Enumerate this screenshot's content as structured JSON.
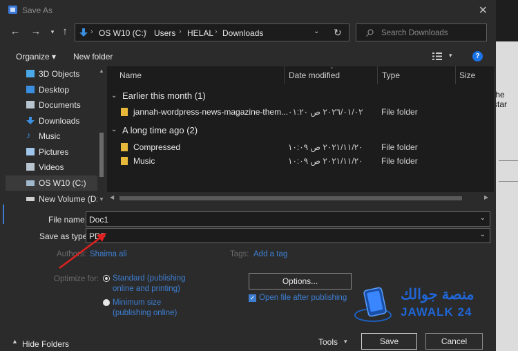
{
  "window": {
    "title": "Save As",
    "close_glyph": "✕"
  },
  "background": {
    "peek_text": "the star"
  },
  "nav": {
    "back_icon": "arrow-left-icon",
    "forward_icon": "arrow-right-icon",
    "recent_icon": "chevron-down-icon",
    "up_icon": "arrow-up-icon",
    "breadcrumbs": [
      "OS W10 (C:)",
      "Users",
      "HELAL",
      "Downloads"
    ],
    "search_placeholder": "Search Downloads"
  },
  "toolbar": {
    "organize_label": "Organize ▾",
    "new_folder_label": "New folder"
  },
  "nav_pane": {
    "items": [
      {
        "label": "3D Objects",
        "icon": "cube-icon",
        "color": "#4aa8e8"
      },
      {
        "label": "Desktop",
        "icon": "desktop-icon",
        "color": "#3b8fe0"
      },
      {
        "label": "Documents",
        "icon": "document-icon",
        "color": "#b8c4d0"
      },
      {
        "label": "Downloads",
        "icon": "download-icon",
        "color": "#3b8fe0"
      },
      {
        "label": "Music",
        "icon": "music-icon",
        "color": "#3b8fe0"
      },
      {
        "label": "Pictures",
        "icon": "picture-icon",
        "color": "#9fc6ea"
      },
      {
        "label": "Videos",
        "icon": "video-icon",
        "color": "#b8c4d0"
      },
      {
        "label": "OS W10 (C:)",
        "icon": "drive-icon",
        "color": "#9fb8cc",
        "selected": true
      },
      {
        "label": "New Volume (D:",
        "icon": "drive-icon",
        "color": "#cfcfcf"
      }
    ]
  },
  "file_list": {
    "columns": [
      "Name",
      "Date modified",
      "Type",
      "Size"
    ],
    "groups": [
      {
        "label": "Earlier this month (1)",
        "rows": [
          {
            "name": "jannah-wordpress-news-magazine-them...",
            "date": "٢٠٢٦/٠١/٠٢ ص ٠١:٢٠",
            "type": "File folder"
          }
        ]
      },
      {
        "label": "A long time ago (2)",
        "rows": [
          {
            "name": "Compressed",
            "date": "٢٠٢١/١١/٢٠ ص ١٠:٠٩",
            "type": "File folder"
          },
          {
            "name": "Music",
            "date": "٢٠٢١/١١/٢٠ ص ١٠:٠٩",
            "type": "File folder"
          }
        ]
      }
    ]
  },
  "form": {
    "file_name_label": "File name:",
    "file_name_value": "Doc1",
    "save_type_label": "Save as type:",
    "save_type_value": "PDF",
    "authors_label": "Authors:",
    "authors_value": "Shaima ali",
    "tags_label": "Tags:",
    "tags_value": "Add a tag",
    "optimize_label": "Optimize for:",
    "optimize_standard": "Standard (publishing online and printing)",
    "optimize_minimum": "Minimum size (publishing online)",
    "options_button": "Options...",
    "open_after_label": "Open file after publishing"
  },
  "watermark": {
    "arabic": "منصة جوالك",
    "latin": "JAWALK 24"
  },
  "footer": {
    "hide_folders": "Hide Folders",
    "tools_label": "Tools",
    "save_button": "Save",
    "cancel_button": "Cancel"
  },
  "colors": {
    "accent": "#3e7fd3",
    "folder": "#e8b83a",
    "arrow": "#e02020"
  }
}
